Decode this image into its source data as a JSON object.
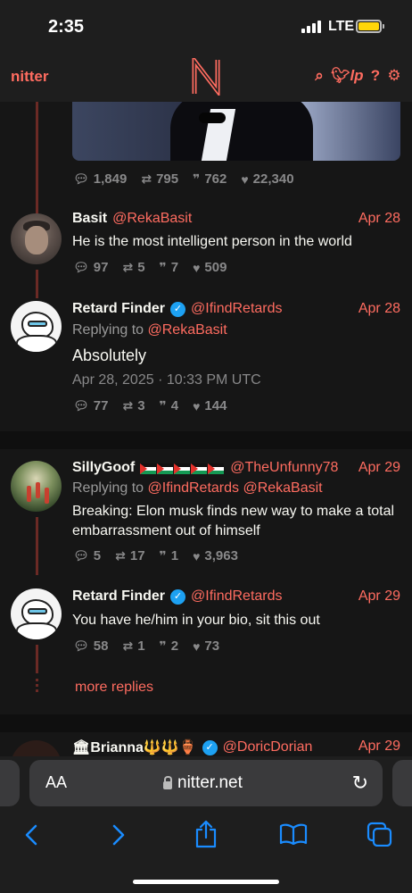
{
  "status_bar": {
    "time": "2:35",
    "network": "LTE"
  },
  "nav": {
    "brand": "nitter",
    "logo_letter": "N",
    "icons": [
      "search-icon",
      "twitter-bird-icon",
      "lp-icon",
      "help-icon",
      "settings-icon"
    ]
  },
  "colors": {
    "accent": "#ff6c60",
    "background": "#161616",
    "verified": "#1da1f2"
  },
  "tweets": [
    {
      "stats": {
        "replies": "1,849",
        "retweets": "795",
        "quotes": "762",
        "likes": "22,340"
      }
    },
    {
      "name": "Basit",
      "handle": "@RekaBasit",
      "date": "Apr 28",
      "text": "He is the most intelligent person in the world",
      "stats": {
        "replies": "97",
        "retweets": "5",
        "quotes": "7",
        "likes": "509"
      }
    },
    {
      "name": "Retard Finder",
      "handle": "@IfindRetards",
      "date": "Apr 28",
      "replying_label": "Replying to",
      "replying_to": "@RekaBasit",
      "text": "Absolutely",
      "full_date": "Apr 28, 2025 · 10:33 PM UTC",
      "stats": {
        "replies": "77",
        "retweets": "3",
        "quotes": "4",
        "likes": "144"
      }
    },
    {
      "name": "SillyGoof",
      "handle": "@TheUnfunny78",
      "date": "Apr 29",
      "replying_label": "Replying to",
      "replying_to": "@IfindRetards @RekaBasit",
      "text": "Breaking: Elon musk finds new way to make a total embarrassment out of himself",
      "stats": {
        "replies": "5",
        "retweets": "17",
        "quotes": "1",
        "likes": "3,963"
      }
    },
    {
      "name": "Retard Finder",
      "handle": "@IfindRetards",
      "date": "Apr 29",
      "text": "You have he/him in your bio, sit this out",
      "stats": {
        "replies": "58",
        "retweets": "1",
        "quotes": "2",
        "likes": "73"
      }
    },
    {
      "name": "🏛Brianna🔱🔱🏺",
      "handle": "@DoricDorian",
      "date": "Apr 29"
    }
  ],
  "more_replies": "more replies",
  "browser": {
    "aa_label": "AA",
    "host": "nitter.net"
  }
}
